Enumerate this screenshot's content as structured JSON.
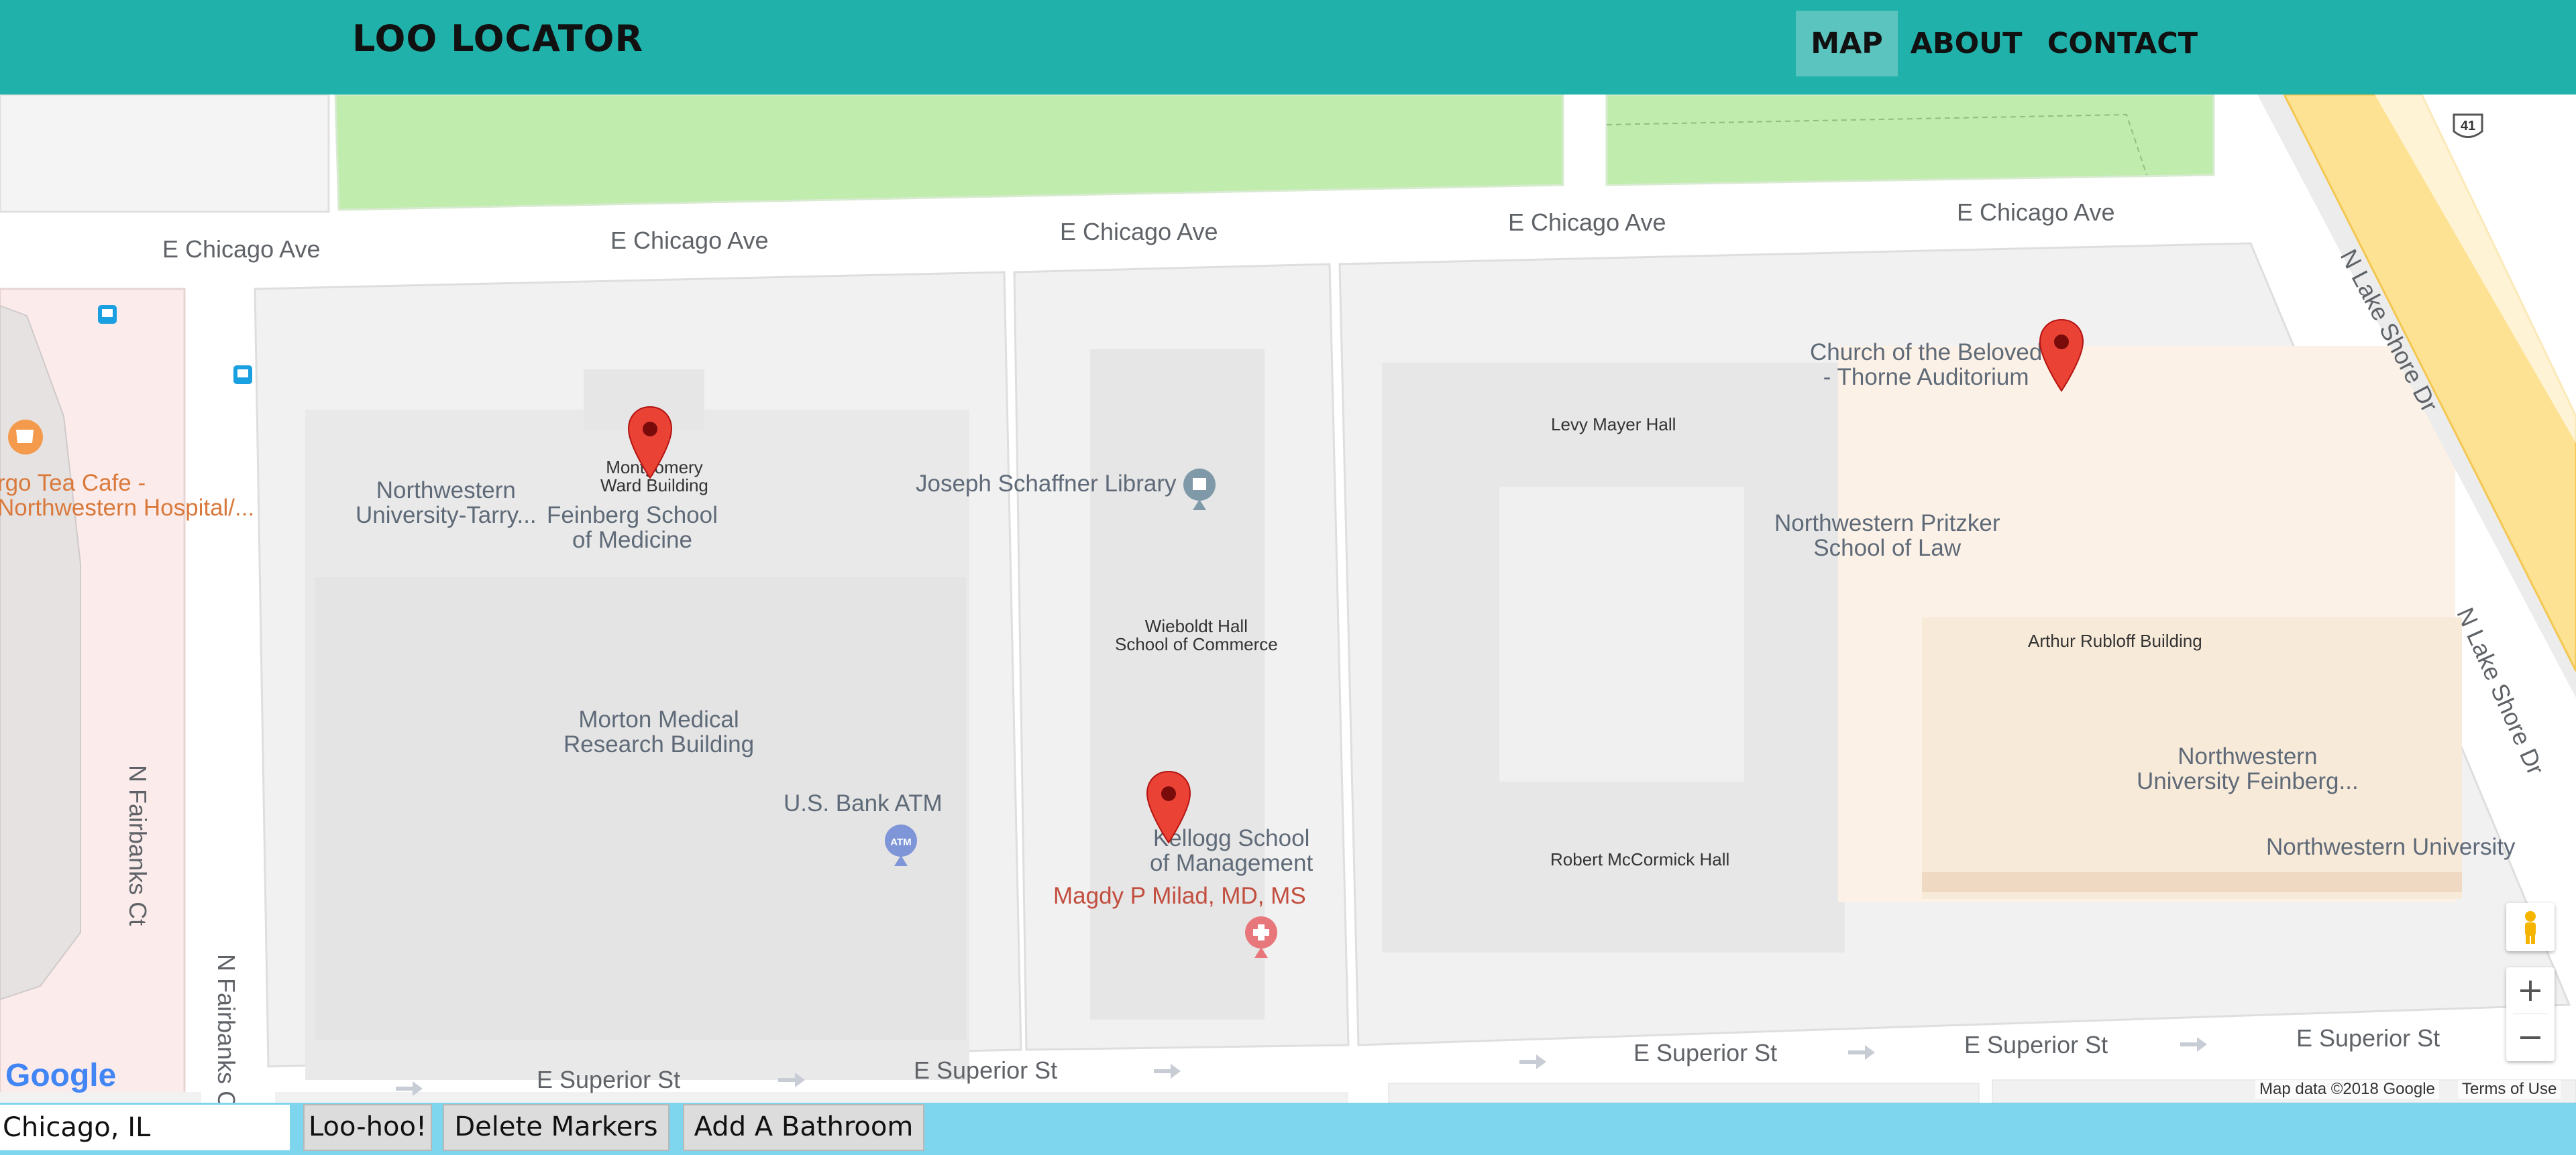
{
  "header": {
    "brand": "LOO LOCATOR",
    "nav": [
      {
        "label": "MAP",
        "active": true
      },
      {
        "label": "ABOUT",
        "active": false
      },
      {
        "label": "CONTACT",
        "active": false
      }
    ]
  },
  "map": {
    "streets": {
      "chicago_ave": "E Chicago Ave",
      "superior_st": "E Superior St",
      "fairbanks_ct": "N Fairbanks Ct",
      "fairbanks_ct_cut": "N Fairbanks C",
      "lake_shore_dr": "N Lake Shore Dr",
      "route_shield": "41"
    },
    "pois": {
      "argo_tea": "Argo Tea Cafe - Northwestern Hospital/...",
      "argo_tea_visible": "rgo Tea Cafe -",
      "argo_tea_visible2": "Northwestern Hospital/...",
      "nw_tarry_1": "Northwestern",
      "nw_tarry_2": "University-Tarry...",
      "montgomery_1": "Montgomery",
      "montgomery_2": "Ward Building",
      "feinberg_1": "Feinberg School",
      "feinberg_2": "of Medicine",
      "morton_1": "Morton Medical",
      "morton_2": "Research Building",
      "usbank": "U.S. Bank ATM",
      "schaffner": "Joseph Schaffner Library",
      "wieboldt_1": "Wieboldt Hall",
      "wieboldt_2": "School of Commerce",
      "kellogg_1": "Kellogg School",
      "kellogg_2": "of Management",
      "milad": "Magdy P Milad, MD, MS",
      "levy": "Levy Mayer Hall",
      "mccormick": "Robert McCormick Hall",
      "church_1": "Church of the Beloved",
      "church_2": "- Thorne Auditorium",
      "pritzker_1": "Northwestern Pritzker",
      "pritzker_2": "School of Law",
      "rubloff": "Arthur Rubloff Building",
      "nw_feinberg_1": "Northwestern",
      "nw_feinberg_2": "University Feinberg...",
      "nw_university": "Northwestern University",
      "atm_badge": "ATM"
    },
    "attribution": {
      "logo": "Google",
      "map_data": "Map data ©2018 Google",
      "terms": "Terms of Use"
    },
    "controls": {
      "zoom_in": "+",
      "zoom_out": "−"
    }
  },
  "footer": {
    "location_value": "Chicago, IL",
    "buttons": {
      "loo": "Loo-hoo!",
      "delete": "Delete Markers",
      "add": "Add A Bathroom"
    }
  },
  "colors": {
    "header_bg": "#20b2aa",
    "nav_active_bg": "#5cc4bf",
    "footer_bg": "#7dd6ee",
    "marker_red": "#ea4335",
    "park_green": "#c0ecae",
    "highway_yellow": "#fde293"
  }
}
